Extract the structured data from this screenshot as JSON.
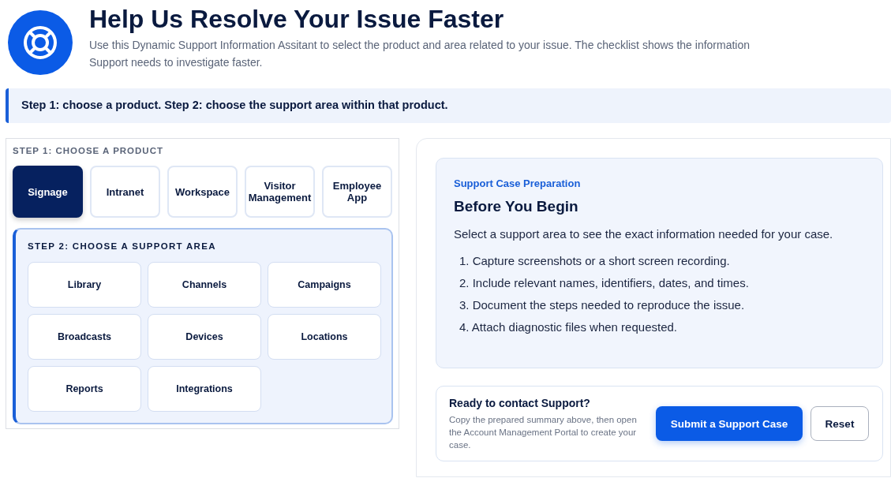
{
  "header": {
    "title": "Help Us Resolve Your Issue Faster",
    "description": "Use this Dynamic Support Information Assitant to select the product and area related to your issue. The checklist shows the information Support needs to investigate faster."
  },
  "banner": "Step 1: choose a product. Step 2: choose the support area within that product.",
  "products": {
    "heading": "STEP 1: CHOOSE A PRODUCT",
    "items": [
      {
        "label": "Signage",
        "selected": true
      },
      {
        "label": "Intranet",
        "selected": false
      },
      {
        "label": "Workspace",
        "selected": false
      },
      {
        "label": "Visitor Management",
        "selected": false
      },
      {
        "label": "Employee App",
        "selected": false
      }
    ]
  },
  "areas": {
    "heading": "STEP 2: CHOOSE A SUPPORT AREA",
    "items": [
      {
        "label": "Library",
        "selected": false
      },
      {
        "label": "Channels",
        "selected": false
      },
      {
        "label": "Campaigns",
        "selected": false
      },
      {
        "label": "Broadcasts",
        "selected": false
      },
      {
        "label": "Devices",
        "selected": false
      },
      {
        "label": "Locations",
        "selected": false
      },
      {
        "label": "Reports",
        "selected": false
      },
      {
        "label": "Integrations",
        "selected": false
      }
    ]
  },
  "preparation": {
    "eyebrow": "Support Case Preparation",
    "title": "Before You Begin",
    "intro": "Select a support area to see the exact information needed for your case.",
    "steps": [
      "1. Capture screenshots or a short screen recording.",
      "2. Include relevant names, identifiers, dates, and times.",
      "3. Document the steps needed to reproduce the issue.",
      "4. Attach diagnostic files when requested."
    ]
  },
  "contact": {
    "title": "Ready to contact Support?",
    "text": "Copy the prepared summary above, then open the Account Management Portal to create your case.",
    "buttons": [
      "Submit a Support Case",
      "Reset"
    ]
  }
}
